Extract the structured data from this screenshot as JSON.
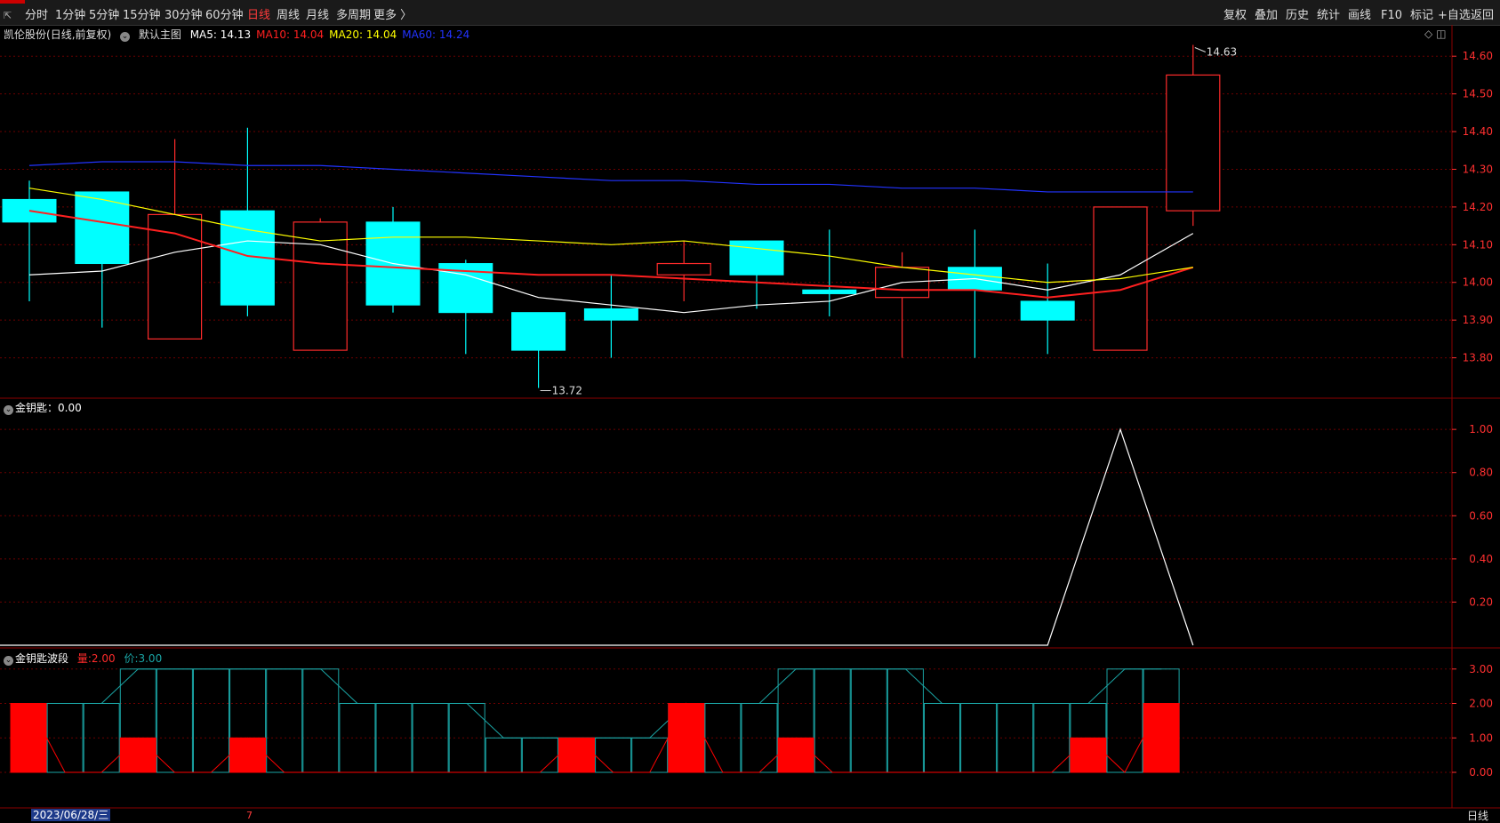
{
  "toolbar": {
    "periods": [
      {
        "label": "分时",
        "active": false
      },
      {
        "label": "1分钟",
        "active": false
      },
      {
        "label": "5分钟",
        "active": false
      },
      {
        "label": "15分钟",
        "active": false
      },
      {
        "label": "30分钟",
        "active": false
      },
      {
        "label": "60分钟",
        "active": false
      },
      {
        "label": "日线",
        "active": true
      },
      {
        "label": "周线",
        "active": false
      },
      {
        "label": "月线",
        "active": false
      },
      {
        "label": "多周期",
        "active": false
      },
      {
        "label": "更多 〉",
        "active": false
      }
    ],
    "right_buttons": [
      "复权",
      "叠加",
      "历史",
      "统计",
      "画线",
      "F10",
      "标记",
      "+自选",
      "返回"
    ]
  },
  "colors": {
    "up": "#ff2b2b",
    "down": "#00ffff",
    "ma5": "#ffffff",
    "ma10": "#ff2020",
    "ma20": "#ffff00",
    "ma60": "#2233ff",
    "grid": "#6b0000",
    "axis": "#ff3030",
    "wave_red": "#ff0000",
    "wave_teal": "#1aa5a5"
  },
  "main": {
    "stock": "凯伦股份",
    "mode": "(日线,前复权)",
    "template": "默认主图",
    "ma": [
      {
        "label": "MA5:",
        "value": "14.13",
        "color": "#ffffff"
      },
      {
        "label": "MA10:",
        "value": "14.04",
        "color": "#ff2020"
      },
      {
        "label": "MA20:",
        "value": "14.04",
        "color": "#ffff00"
      },
      {
        "label": "MA60:",
        "value": "14.24",
        "color": "#2233ff"
      }
    ],
    "high_label": "14.63",
    "low_label": "13.72"
  },
  "indicator1": {
    "name": "金钥匙",
    "value_text": "0.00"
  },
  "indicator2": {
    "name": "金钥匙波段",
    "vol_label": "量:",
    "vol_value": "2.00",
    "price_label": "价:",
    "price_value": "3.00"
  },
  "footer": {
    "date": "2023/06/28/三",
    "marker": "7",
    "period": "日线"
  },
  "chart_data": [
    {
      "type": "candlestick",
      "title": "凯伦股份 (日线,前复权)",
      "ylim": [
        13.7,
        14.65
      ],
      "yticks": [
        "13.80",
        "13.90",
        "14.00",
        "14.10",
        "14.20",
        "14.30",
        "14.40",
        "14.50",
        "14.60"
      ],
      "candles": [
        {
          "o": 14.22,
          "h": 14.27,
          "l": 13.95,
          "c": 14.16
        },
        {
          "o": 14.24,
          "h": 14.24,
          "l": 13.88,
          "c": 14.05
        },
        {
          "o": 13.85,
          "h": 14.38,
          "l": 13.85,
          "c": 14.18
        },
        {
          "o": 14.19,
          "h": 14.41,
          "l": 13.91,
          "c": 13.94
        },
        {
          "o": 13.82,
          "h": 14.17,
          "l": 13.82,
          "c": 14.16
        },
        {
          "o": 14.16,
          "h": 14.2,
          "l": 13.92,
          "c": 13.94
        },
        {
          "o": 14.05,
          "h": 14.06,
          "l": 13.81,
          "c": 13.92
        },
        {
          "o": 13.92,
          "h": 13.92,
          "l": 13.72,
          "c": 13.82
        },
        {
          "o": 13.93,
          "h": 14.02,
          "l": 13.8,
          "c": 13.9
        },
        {
          "o": 14.02,
          "h": 14.11,
          "l": 13.95,
          "c": 14.05
        },
        {
          "o": 14.11,
          "h": 14.11,
          "l": 13.93,
          "c": 14.02
        },
        {
          "o": 13.98,
          "h": 14.14,
          "l": 13.91,
          "c": 13.97
        },
        {
          "o": 13.96,
          "h": 14.08,
          "l": 13.8,
          "c": 14.04
        },
        {
          "o": 14.04,
          "h": 14.14,
          "l": 13.8,
          "c": 13.98
        },
        {
          "o": 13.95,
          "h": 14.05,
          "l": 13.81,
          "c": 13.9
        },
        {
          "o": 13.82,
          "h": 14.2,
          "l": 13.82,
          "c": 14.2
        },
        {
          "o": 14.19,
          "h": 14.63,
          "l": 14.15,
          "c": 14.55
        }
      ],
      "series": [
        {
          "name": "MA5",
          "values": [
            14.02,
            14.03,
            14.08,
            14.11,
            14.1,
            14.05,
            14.02,
            13.96,
            13.94,
            13.92,
            13.94,
            13.95,
            14.0,
            14.01,
            13.98,
            14.02,
            14.13
          ]
        },
        {
          "name": "MA10",
          "values": [
            14.19,
            14.16,
            14.13,
            14.07,
            14.05,
            14.04,
            14.03,
            14.02,
            14.02,
            14.01,
            14.0,
            13.99,
            13.98,
            13.98,
            13.96,
            13.98,
            14.04
          ]
        },
        {
          "name": "MA20",
          "values": [
            14.25,
            14.22,
            14.18,
            14.14,
            14.11,
            14.12,
            14.12,
            14.11,
            14.1,
            14.11,
            14.09,
            14.07,
            14.04,
            14.02,
            14.0,
            14.01,
            14.04
          ]
        },
        {
          "name": "MA60",
          "values": [
            14.31,
            14.32,
            14.32,
            14.31,
            14.31,
            14.3,
            14.29,
            14.28,
            14.27,
            14.27,
            14.26,
            14.26,
            14.25,
            14.25,
            14.24,
            14.24,
            14.24
          ]
        }
      ]
    },
    {
      "type": "line",
      "title": "金钥匙",
      "ylim": [
        0,
        1.05
      ],
      "yticks": [
        "0.20",
        "0.40",
        "0.60",
        "0.80",
        "1.00"
      ],
      "series": [
        {
          "name": "金钥匙",
          "values": [
            0,
            0,
            0,
            0,
            0,
            0,
            0,
            0,
            0,
            0,
            0,
            0,
            0,
            0,
            0,
            1,
            0
          ]
        }
      ]
    },
    {
      "type": "bar",
      "title": "金钥匙波段",
      "ylim": [
        0,
        3.2
      ],
      "yticks": [
        "0.00",
        "1.00",
        "2.00",
        "3.00"
      ],
      "series": [
        {
          "name": "量",
          "values": [
            2,
            0,
            0,
            1,
            0,
            0,
            1,
            0,
            0,
            0,
            0,
            0,
            0,
            0,
            0,
            1,
            0,
            0,
            2,
            0,
            0,
            1,
            0,
            0,
            0,
            0,
            0,
            0,
            0,
            1,
            0,
            2
          ]
        },
        {
          "name": "价",
          "values": [
            2,
            2,
            2,
            3,
            3,
            3,
            3,
            3,
            3,
            2,
            2,
            2,
            2,
            1,
            1,
            1,
            1,
            1,
            2,
            2,
            2,
            3,
            3,
            3,
            3,
            2,
            2,
            2,
            2,
            2,
            3,
            3
          ]
        }
      ]
    }
  ]
}
